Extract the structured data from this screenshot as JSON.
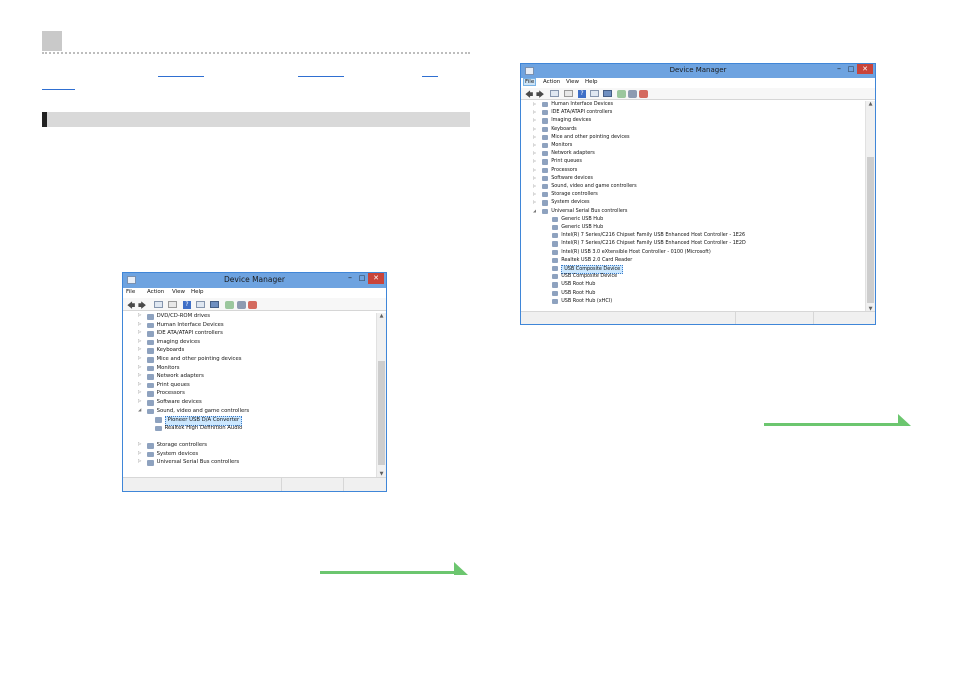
{
  "window_left": {
    "title": "Device Manager",
    "menu": [
      "File",
      "Action",
      "View",
      "Help"
    ],
    "tree": [
      {
        "label": "DVD/CD-ROM drives",
        "level": 1,
        "expander": "▷",
        "icon": "dvd-drive-icon"
      },
      {
        "label": "Human Interface Devices",
        "level": 1,
        "expander": "▷",
        "icon": "hid-icon"
      },
      {
        "label": "IDE ATA/ATAPI controllers",
        "level": 1,
        "expander": "▷",
        "icon": "ide-controller-icon"
      },
      {
        "label": "Imaging devices",
        "level": 1,
        "expander": "▷",
        "icon": "camera-icon"
      },
      {
        "label": "Keyboards",
        "level": 1,
        "expander": "▷",
        "icon": "keyboard-icon"
      },
      {
        "label": "Mice and other pointing devices",
        "level": 1,
        "expander": "▷",
        "icon": "mouse-icon"
      },
      {
        "label": "Monitors",
        "level": 1,
        "expander": "▷",
        "icon": "monitor-icon"
      },
      {
        "label": "Network adapters",
        "level": 1,
        "expander": "▷",
        "icon": "network-adapter-icon"
      },
      {
        "label": "Print queues",
        "level": 1,
        "expander": "▷",
        "icon": "printer-icon"
      },
      {
        "label": "Processors",
        "level": 1,
        "expander": "▷",
        "icon": "processor-icon"
      },
      {
        "label": "Software devices",
        "level": 1,
        "expander": "▷",
        "icon": "software-device-icon"
      },
      {
        "label": "Sound, video and game controllers",
        "level": 1,
        "expander": "◢",
        "icon": "speaker-icon"
      },
      {
        "label": "Pioneer USB D/A Converter",
        "level": 2,
        "expander": "",
        "icon": "speaker-icon",
        "selected": true
      },
      {
        "label": "Realtek High Definition Audio",
        "level": 2,
        "expander": "",
        "icon": "speaker-icon"
      },
      {
        "label": "",
        "level": 1,
        "expander": "",
        "icon": ""
      },
      {
        "label": "Storage controllers",
        "level": 1,
        "expander": "▷",
        "icon": "storage-controller-icon"
      },
      {
        "label": "System devices",
        "level": 1,
        "expander": "▷",
        "icon": "system-device-icon"
      },
      {
        "label": "Universal Serial Bus controllers",
        "level": 1,
        "expander": "▷",
        "icon": "usb-icon"
      }
    ]
  },
  "window_right": {
    "title": "Device Manager",
    "menu": [
      "File",
      "Action",
      "View",
      "Help"
    ],
    "active_menu": "File",
    "tree": [
      {
        "label": "Human Interface Devices",
        "level": 1,
        "expander": "▷",
        "icon": "hid-icon"
      },
      {
        "label": "IDE ATA/ATAPI controllers",
        "level": 1,
        "expander": "▷",
        "icon": "ide-controller-icon"
      },
      {
        "label": "Imaging devices",
        "level": 1,
        "expander": "▷",
        "icon": "camera-icon"
      },
      {
        "label": "Keyboards",
        "level": 1,
        "expander": "▷",
        "icon": "keyboard-icon"
      },
      {
        "label": "Mice and other pointing devices",
        "level": 1,
        "expander": "▷",
        "icon": "mouse-icon"
      },
      {
        "label": "Monitors",
        "level": 1,
        "expander": "▷",
        "icon": "monitor-icon"
      },
      {
        "label": "Network adapters",
        "level": 1,
        "expander": "▷",
        "icon": "network-adapter-icon"
      },
      {
        "label": "Print queues",
        "level": 1,
        "expander": "▷",
        "icon": "printer-icon"
      },
      {
        "label": "Processors",
        "level": 1,
        "expander": "▷",
        "icon": "processor-icon"
      },
      {
        "label": "Software devices",
        "level": 1,
        "expander": "▷",
        "icon": "software-device-icon"
      },
      {
        "label": "Sound, video and game controllers",
        "level": 1,
        "expander": "▷",
        "icon": "speaker-icon"
      },
      {
        "label": "Storage controllers",
        "level": 1,
        "expander": "▷",
        "icon": "storage-controller-icon"
      },
      {
        "label": "System devices",
        "level": 1,
        "expander": "▷",
        "icon": "system-device-icon"
      },
      {
        "label": "Universal Serial Bus controllers",
        "level": 1,
        "expander": "◢",
        "icon": "usb-icon"
      },
      {
        "label": "Generic USB Hub",
        "level": 2,
        "expander": "",
        "icon": "usb-plug-icon"
      },
      {
        "label": "Generic USB Hub",
        "level": 2,
        "expander": "",
        "icon": "usb-plug-icon"
      },
      {
        "label": "Intel(R) 7 Series/C216 Chipset Family USB Enhanced Host Controller - 1E26",
        "level": 2,
        "expander": "",
        "icon": "usb-plug-icon"
      },
      {
        "label": "Intel(R) 7 Series/C216 Chipset Family USB Enhanced Host Controller - 1E2D",
        "level": 2,
        "expander": "",
        "icon": "usb-plug-icon"
      },
      {
        "label": "Intel(R) USB 3.0 eXtensible Host Controller - 0100 (Microsoft)",
        "level": 2,
        "expander": "",
        "icon": "usb-plug-icon"
      },
      {
        "label": "Realtek USB 2.0 Card Reader",
        "level": 2,
        "expander": "",
        "icon": "usb-plug-icon"
      },
      {
        "label": "USB Composite Device",
        "level": 2,
        "expander": "",
        "icon": "usb-plug-icon",
        "selected": true
      },
      {
        "label": "USB Composite Device",
        "level": 2,
        "expander": "",
        "icon": "usb-plug-icon"
      },
      {
        "label": "USB Root Hub",
        "level": 2,
        "expander": "",
        "icon": "usb-plug-icon"
      },
      {
        "label": "USB Root Hub",
        "level": 2,
        "expander": "",
        "icon": "usb-plug-icon"
      },
      {
        "label": "USB Root Hub (xHCI)",
        "level": 2,
        "expander": "",
        "icon": "usb-plug-icon"
      }
    ]
  },
  "colors": {
    "titlebar": "#6ea3e0",
    "close_button": "#c9443a",
    "selection": "#cce8ff",
    "arrow_green": "#6cc66f",
    "link_blue": "#2f6fd1"
  }
}
